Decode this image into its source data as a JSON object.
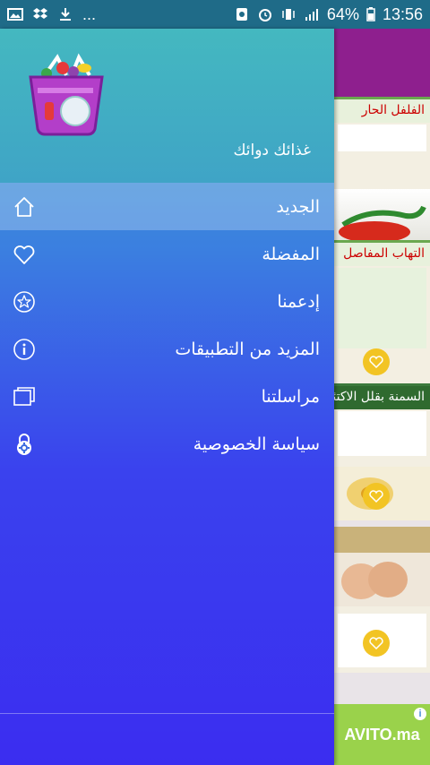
{
  "status_bar": {
    "more": "...",
    "battery": "64%",
    "time": "13:56"
  },
  "drawer": {
    "app_name": "غذائك دوائك",
    "logo_icon": "shopping-basket-logo",
    "menu": [
      {
        "label": "الجديد",
        "icon": "home-icon",
        "active": true
      },
      {
        "label": "المفضلة",
        "icon": "heart-icon"
      },
      {
        "label": "إدعمنا",
        "icon": "star-badge-icon"
      },
      {
        "label": "المزيد من التطبيقات",
        "icon": "info-icon"
      },
      {
        "label": "مراسلتنا",
        "icon": "folders-icon"
      },
      {
        "label": "سياسة الخصوصية",
        "icon": "lock-gear-icon"
      }
    ]
  },
  "background": {
    "card_titles": [
      "الفلفل الحار",
      "التهاب المفاصل",
      "السمنة بقلل الاكتئاب",
      ""
    ],
    "ad_label": "AVITO.ma"
  },
  "colors": {
    "status_bar": "#1f6b88",
    "drawer_top": "#44b8c0",
    "drawer_bottom": "#3b2df0",
    "heart_fab": "#f2c424",
    "app_bar": "#8e1f8e"
  }
}
